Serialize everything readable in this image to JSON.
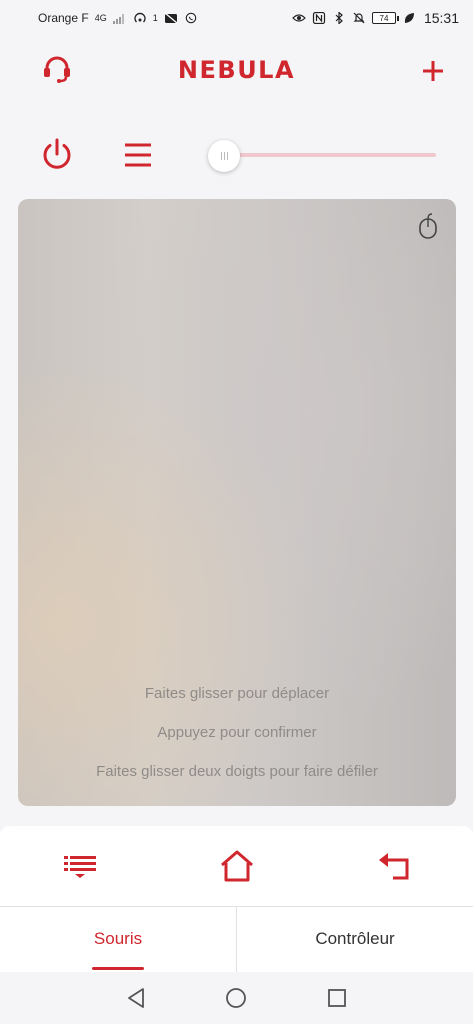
{
  "status_bar": {
    "carrier": "Orange F",
    "network": "4G",
    "hotspot_count": "1",
    "battery": "74",
    "time": "15:31"
  },
  "header": {
    "brand": "NEBULA",
    "support_icon": "headset-icon",
    "add_icon": "plus-icon"
  },
  "controls": {
    "power_icon": "power-icon",
    "menu_icon": "menu-icon",
    "slider_value": 0
  },
  "touchpad": {
    "mouse_icon": "mouse-icon",
    "hints": [
      "Faites glisser pour déplacer",
      "Appuyez pour confirmer",
      "Faites glisser deux doigts pour faire défiler"
    ]
  },
  "nav_buttons": [
    "list-menu-icon",
    "home-icon",
    "back-arrow-icon"
  ],
  "tabs": [
    {
      "label": "Souris",
      "active": true
    },
    {
      "label": "Contrôleur",
      "active": false
    }
  ],
  "colors": {
    "accent": "#d0262d",
    "background": "#f5f5f7",
    "slider_track": "#f0c9cc"
  }
}
